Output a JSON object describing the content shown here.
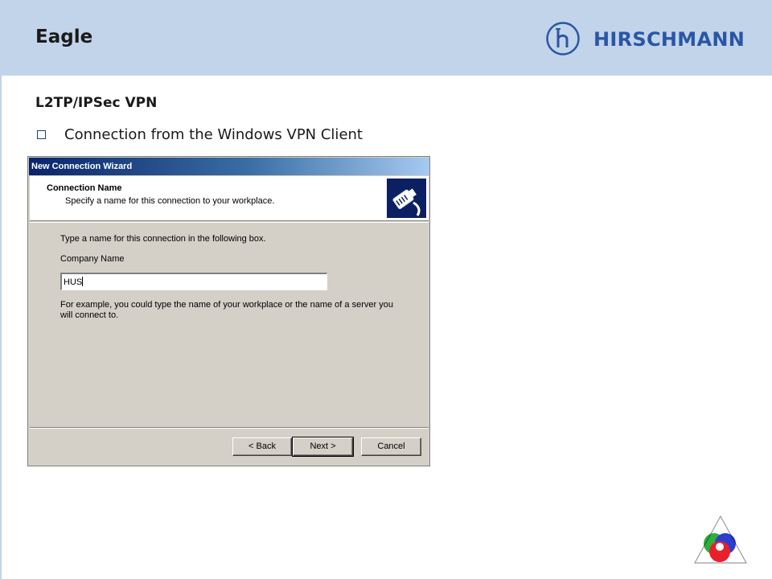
{
  "slide": {
    "title": "Eagle",
    "brand": "HIRSCHMANN",
    "subtitle": "L2TP/IPSec VPN",
    "bullet": "Connection from the Windows VPN Client"
  },
  "wizard": {
    "window_title": "New Connection Wizard",
    "header_title": "Connection Name",
    "header_subtitle": "Specify a name for this connection to your workplace.",
    "instruction": "Type a name for this connection in the following box.",
    "field_label": "Company Name",
    "field_value": "HUS",
    "example_line1": "For example, you could type the name of your workplace or the name of a server you",
    "example_line2": "will connect to.",
    "buttons": {
      "back": "< Back",
      "next": "Next >",
      "cancel": "Cancel"
    }
  },
  "icons": {
    "logo": "hirschmann-h-logo",
    "wizard": "network-cable-icon",
    "bullet": "square-bullet-icon",
    "corner": "rgb-circles-triangle-logo"
  },
  "colors": {
    "header_band": "#c2d4ea",
    "brand_blue": "#2a56a4",
    "titlebar_start": "#0a246a",
    "dialog_face": "#d4d0c8"
  }
}
